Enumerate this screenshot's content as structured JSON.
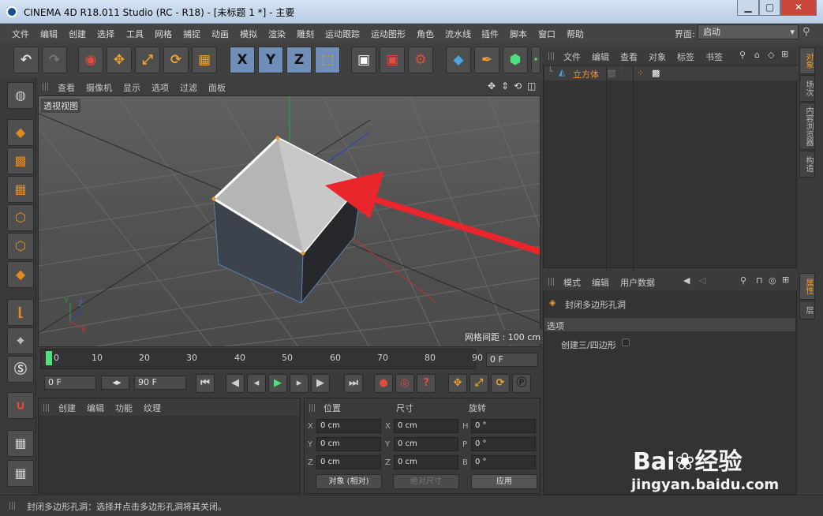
{
  "window": {
    "title": "CINEMA 4D R18.011 Studio (RC - R18) - [未标题 1 *] - 主要",
    "min": "▁",
    "max": "▢",
    "close": "✕"
  },
  "menu": [
    "文件",
    "编辑",
    "创建",
    "选择",
    "工具",
    "网格",
    "捕捉",
    "动画",
    "模拟",
    "渲染",
    "雕刻",
    "运动跟踪",
    "运动图形",
    "角色",
    "流水线",
    "插件",
    "脚本",
    "窗口",
    "帮助"
  ],
  "layout": {
    "label": "界面:",
    "value": "启动"
  },
  "toolbar": {
    "undo": "↶",
    "redo": "↷",
    "move": "✥",
    "scale": "⤢",
    "rotate": "⟳",
    "x": "X",
    "y": "Y",
    "z": "Z"
  },
  "viewport": {
    "menu": [
      "查看",
      "摄像机",
      "显示",
      "选项",
      "过滤",
      "面板"
    ],
    "label": "透视视图",
    "grid": "网格间距 : 100 cm",
    "axis": {
      "x": "X",
      "y": "Y",
      "z": "Z"
    }
  },
  "timeline": {
    "ticks": [
      "0",
      "10",
      "20",
      "30",
      "40",
      "50",
      "60",
      "70",
      "80",
      "90"
    ],
    "end_field": "0 F"
  },
  "transport": {
    "start": "0 F",
    "end": "90 F"
  },
  "material": {
    "menu": [
      "创建",
      "编辑",
      "功能",
      "纹理"
    ]
  },
  "coords": {
    "headers": [
      "位置",
      "尺寸",
      "旋转"
    ],
    "rows": [
      {
        "a": "X",
        "p": "0 cm",
        "b": "X",
        "s": "0 cm",
        "c": "H",
        "r": "0 °"
      },
      {
        "a": "Y",
        "p": "0 cm",
        "b": "Y",
        "s": "0 cm",
        "c": "P",
        "r": "0 °"
      },
      {
        "a": "Z",
        "p": "0 cm",
        "b": "Z",
        "s": "0 cm",
        "c": "B",
        "r": "0 °"
      }
    ],
    "mode": "对象 (相对)",
    "size_mode": "绝对尺寸",
    "apply": "应用"
  },
  "objects": {
    "menu": [
      "文件",
      "编辑",
      "查看",
      "对象",
      "标签",
      "书签"
    ],
    "item": "立方体"
  },
  "attributes": {
    "menu": [
      "模式",
      "编辑",
      "用户数据"
    ],
    "tool": "封闭多边形孔洞",
    "section": "选项",
    "option": "创建三/四边形"
  },
  "right_tabs": [
    "对象",
    "场次",
    "内容浏览器",
    "构造"
  ],
  "right_tabs2": [
    "属性",
    "层"
  ],
  "status": "封闭多边形孔洞：选择并点击多边形孔洞将其关闭。",
  "watermark": {
    "brand": "Bai",
    "brand2": "经验",
    "url": "jingyan.baidu.com"
  },
  "colors": {
    "accent": "#f09a2a",
    "arrow": "#e8262b",
    "selection": "#6f8fb8"
  }
}
